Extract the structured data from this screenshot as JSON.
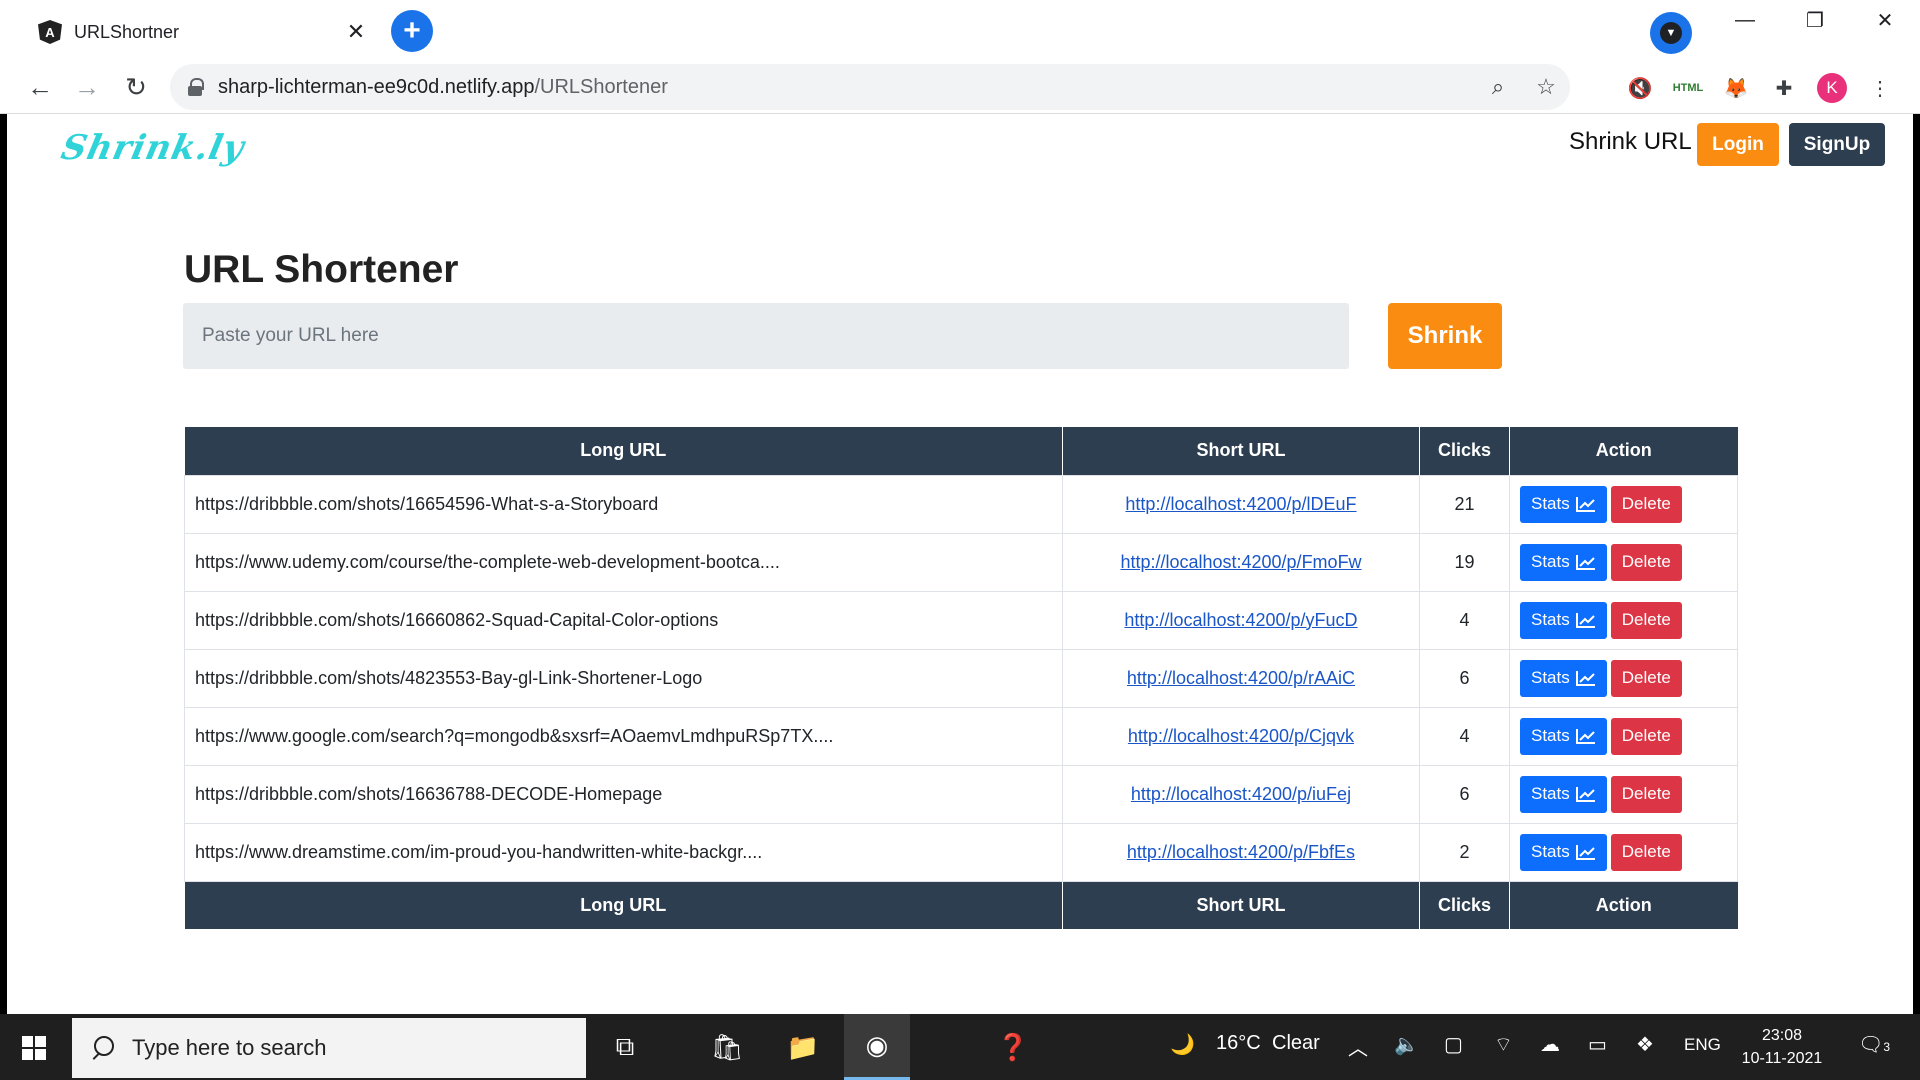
{
  "browser": {
    "tab_title": "URLShortner",
    "tab_close": "✕",
    "favicon_letter": "A",
    "new_tab": "+",
    "url_host": "sharp-lichterman-ee9c0d.netlify.app",
    "url_path": "/URLShortener",
    "ext_avatar_letter": "K",
    "ext_html_label": "HTML"
  },
  "site": {
    "logo": "Shrink.ly",
    "nav_link": "Shrink URL",
    "login_label": "Login",
    "signup_label": "SignUp"
  },
  "main": {
    "heading": "URL Shortener",
    "input_placeholder": "Paste your URL here",
    "shrink_label": "Shrink"
  },
  "table": {
    "headers": [
      "Long URL",
      "Short URL",
      "Clicks",
      "Action"
    ],
    "footers": [
      "Long URL",
      "Short URL",
      "Clicks",
      "Action"
    ],
    "stats_label": "Stats",
    "delete_label": "Delete",
    "rows": [
      {
        "long": "https://dribbble.com/shots/16654596-What-s-a-Storyboard",
        "short": "http://localhost:4200/p/lDEuF",
        "clicks": "21"
      },
      {
        "long": "https://www.udemy.com/course/the-complete-web-development-bootca....",
        "short": "http://localhost:4200/p/FmoFw",
        "clicks": "19"
      },
      {
        "long": "https://dribbble.com/shots/16660862-Squad-Capital-Color-options",
        "short": "http://localhost:4200/p/yFucD",
        "clicks": "4"
      },
      {
        "long": "https://dribbble.com/shots/4823553-Bay-gl-Link-Shortener-Logo",
        "short": "http://localhost:4200/p/rAAiC",
        "clicks": "6"
      },
      {
        "long": "https://www.google.com/search?q=mongodb&sxsrf=AOaemvLmdhpuRSp7TX....",
        "short": "http://localhost:4200/p/Cjqvk",
        "clicks": "4"
      },
      {
        "long": "https://dribbble.com/shots/16636788-DECODE-Homepage",
        "short": "http://localhost:4200/p/iuFej",
        "clicks": "6"
      },
      {
        "long": "https://www.dreamstime.com/im-proud-you-handwritten-white-backgr....",
        "short": "http://localhost:4200/p/FbfEs",
        "clicks": "2"
      }
    ]
  },
  "taskbar": {
    "search_placeholder": "Type here to search",
    "weather_temp": "16°C",
    "weather_desc": "Clear",
    "lang": "ENG",
    "time": "23:08",
    "date": "10-11-2021",
    "notifications": "3"
  },
  "colors": {
    "accent_orange": "#fb8c12",
    "header_navy": "#2d3e50",
    "stats_blue": "#0d6efd",
    "delete_red": "#dc3545",
    "logo_cyan": "#2fd3d8"
  }
}
